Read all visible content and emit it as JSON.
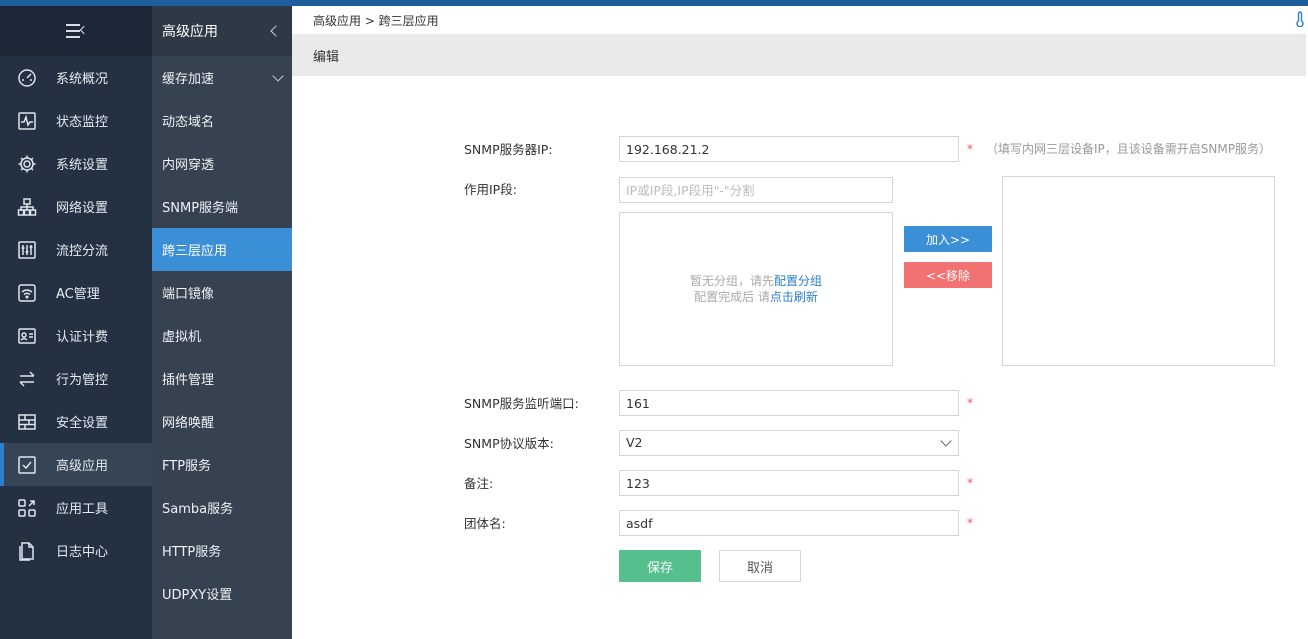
{
  "sidebar": {
    "items": [
      {
        "label": "系统概况",
        "icon": "gauge-icon"
      },
      {
        "label": "状态监控",
        "icon": "pulse-icon"
      },
      {
        "label": "系统设置",
        "icon": "gear-icon"
      },
      {
        "label": "网络设置",
        "icon": "network-icon"
      },
      {
        "label": "流控分流",
        "icon": "sliders-icon"
      },
      {
        "label": "AC管理",
        "icon": "wifi-icon"
      },
      {
        "label": "认证计费",
        "icon": "id-card-icon"
      },
      {
        "label": "行为管控",
        "icon": "swap-icon"
      },
      {
        "label": "安全设置",
        "icon": "firewall-icon"
      },
      {
        "label": "高级应用",
        "icon": "checkbox-icon"
      },
      {
        "label": "应用工具",
        "icon": "tools-icon"
      },
      {
        "label": "日志中心",
        "icon": "document-icon"
      }
    ]
  },
  "subnav": {
    "title": "高级应用",
    "items": [
      {
        "label": "缓存加速"
      },
      {
        "label": "动态域名"
      },
      {
        "label": "内网穿透"
      },
      {
        "label": "SNMP服务端"
      },
      {
        "label": "跨三层应用"
      },
      {
        "label": "端口镜像"
      },
      {
        "label": "虚拟机"
      },
      {
        "label": "插件管理"
      },
      {
        "label": "网络唤醒"
      },
      {
        "label": "FTP服务"
      },
      {
        "label": "Samba服务"
      },
      {
        "label": "HTTP服务"
      },
      {
        "label": "UDPXY设置"
      }
    ]
  },
  "breadcrumb": "高级应用 > 跨三层应用",
  "section_title": "编辑",
  "form": {
    "snmp_ip_label": "SNMP服务器IP:",
    "snmp_ip_value": "192.168.21.2",
    "snmp_ip_hint": "（填写内网三层设备IP，且该设备需开启SNMP服务）",
    "ip_range_label": "作用IP段:",
    "ip_range_placeholder": "IP或IP段,IP段用\"-\"分割",
    "empty_text_1": "暂无分组，请先",
    "empty_link_1": "配置分组",
    "empty_text_2": "配置完成后 请",
    "empty_link_2": "点击刷新",
    "add_button": "加入>>",
    "remove_button": "<<移除",
    "port_label": "SNMP服务监听端口:",
    "port_value": "161",
    "version_label": "SNMP协议版本:",
    "version_value": "V2",
    "remark_label": "备注:",
    "remark_value": "123",
    "community_label": "团体名:",
    "community_value": "asdf",
    "required_mark": "*",
    "save_button": "保存",
    "cancel_button": "取消"
  }
}
